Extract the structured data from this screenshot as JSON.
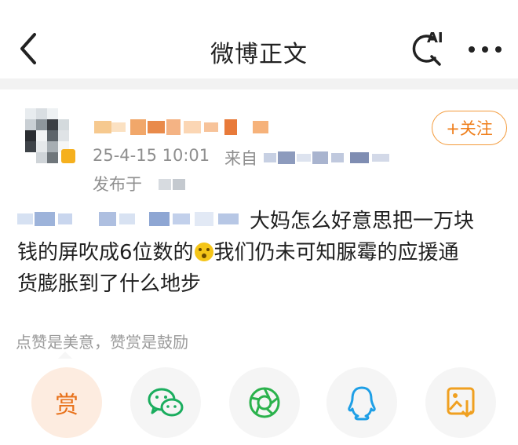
{
  "header": {
    "title": "微博正文",
    "ai_label": "AI"
  },
  "post": {
    "time": "25-4-15 10:01",
    "from_label": "来自",
    "location_label": "发布于",
    "follow_label": "+关注",
    "text_line1": "大妈怎么好意思把一万块",
    "text_line2a": "钱的屏吹成6位数的",
    "text_line2b": "我们仍未可知脲霉的应援通",
    "text_line3": "货膨胀到了什么地步"
  },
  "reward": {
    "hint": "点赞是美意，赞赏是鼓励",
    "label": "赏"
  },
  "share": {
    "items": [
      "reward",
      "wechat",
      "moments",
      "qq",
      "save-image"
    ]
  },
  "colors": {
    "accent": "#ef7e1a",
    "wechat": "#1aad5e",
    "moments": "#2bb24c",
    "qq": "#1e9fe6",
    "save": "#f0a020"
  }
}
